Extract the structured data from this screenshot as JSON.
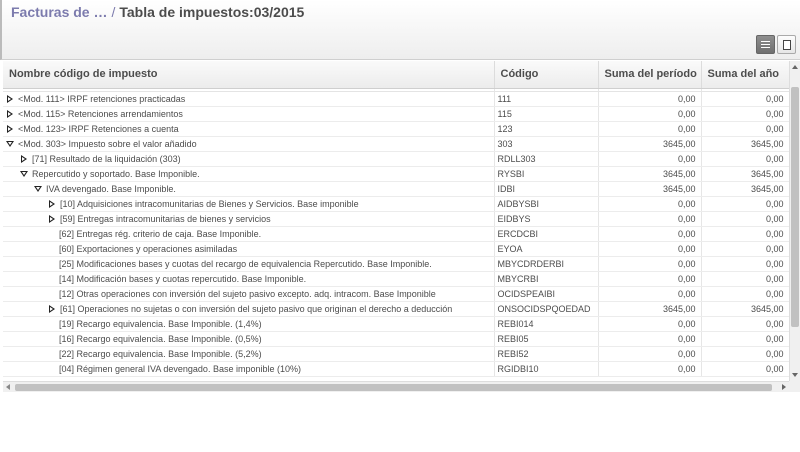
{
  "breadcrumb": {
    "parent": "Facturas de …",
    "separator": "/",
    "current": "Tabla de impuestos:03/2015"
  },
  "view_switcher": {
    "list_icon": "list-view-icon",
    "form_icon": "form-view-icon",
    "active": "list"
  },
  "table": {
    "headers": {
      "name": "Nombre código de impuesto",
      "code": "Código",
      "period_sum": "Suma del período",
      "year_sum": "Suma del año"
    },
    "rows": [
      {
        "name": "<Mod. 111> IRPF retenciones practicadas",
        "code": "111",
        "period": "0,00",
        "year": "0,00",
        "level": 0,
        "toggle": "collapsed"
      },
      {
        "name": "<Mod. 115> Retenciones arrendamientos",
        "code": "115",
        "period": "0,00",
        "year": "0,00",
        "level": 0,
        "toggle": "collapsed"
      },
      {
        "name": "<Mod. 123> IRPF Retenciones a cuenta",
        "code": "123",
        "period": "0,00",
        "year": "0,00",
        "level": 0,
        "toggle": "collapsed"
      },
      {
        "name": "<Mod. 303> Impuesto sobre el valor añadido",
        "code": "303",
        "period": "3645,00",
        "year": "3645,00",
        "level": 0,
        "toggle": "expanded"
      },
      {
        "name": "[71] Resultado de la liquidación (303)",
        "code": "RDLL303",
        "period": "0,00",
        "year": "0,00",
        "level": 1,
        "toggle": "collapsed"
      },
      {
        "name": "Repercutido y soportado. Base Imponible.",
        "code": "RYSBI",
        "period": "3645,00",
        "year": "3645,00",
        "level": 1,
        "toggle": "expanded"
      },
      {
        "name": "IVA devengado. Base Imponible.",
        "code": "IDBI",
        "period": "3645,00",
        "year": "3645,00",
        "level": 2,
        "toggle": "expanded"
      },
      {
        "name": "[10] Adquisiciones intracomunitarias de Bienes y Servicios. Base imponible",
        "code": "AIDBYSBI",
        "period": "0,00",
        "year": "0,00",
        "level": 3,
        "toggle": "collapsed"
      },
      {
        "name": "[59] Entregas intracomunitarias de bienes y servicios",
        "code": "EIDBYS",
        "period": "0,00",
        "year": "0,00",
        "level": 3,
        "toggle": "collapsed"
      },
      {
        "name": "[62] Entregas rég. criterio de caja. Base Imponible.",
        "code": "ERCDCBI",
        "period": "0,00",
        "year": "0,00",
        "level": 3,
        "toggle": "none"
      },
      {
        "name": "[60] Exportaciones y operaciones asimiladas",
        "code": "EYOA",
        "period": "0,00",
        "year": "0,00",
        "level": 3,
        "toggle": "none"
      },
      {
        "name": "[25] Modificaciones bases y cuotas del recargo de equivalencia Repercutido. Base Imponible.",
        "code": "MBYCDRDERBI",
        "period": "0,00",
        "year": "0,00",
        "level": 3,
        "toggle": "none"
      },
      {
        "name": "[14] Modificación bases y cuotas repercutido. Base Imponible.",
        "code": "MBYCRBI",
        "period": "0,00",
        "year": "0,00",
        "level": 3,
        "toggle": "none"
      },
      {
        "name": "[12] Otras operaciones con inversión del sujeto pasivo excepto. adq. intracom. Base Imponible",
        "code": "OCIDSPEAIBI",
        "period": "0,00",
        "year": "0,00",
        "level": 3,
        "toggle": "none"
      },
      {
        "name": "[61] Operaciones no sujetas o con inversión del sujeto pasivo que originan el derecho a deducción",
        "code": "ONSOCIDSPQOEDAD",
        "period": "3645,00",
        "year": "3645,00",
        "level": 3,
        "toggle": "collapsed"
      },
      {
        "name": "[19] Recargo equivalencia. Base Imponible. (1,4%)",
        "code": "REBI014",
        "period": "0,00",
        "year": "0,00",
        "level": 3,
        "toggle": "none"
      },
      {
        "name": "[16] Recargo equivalencia. Base Imponible. (0,5%)",
        "code": "REBI05",
        "period": "0,00",
        "year": "0,00",
        "level": 3,
        "toggle": "none"
      },
      {
        "name": "[22] Recargo equivalencia. Base Imponible. (5,2%)",
        "code": "REBI52",
        "period": "0,00",
        "year": "0,00",
        "level": 3,
        "toggle": "none"
      },
      {
        "name": "[04] Régimen general IVA devengado. Base imponible (10%)",
        "code": "RGIDBI10",
        "period": "0,00",
        "year": "0,00",
        "level": 3,
        "toggle": "none"
      }
    ]
  }
}
